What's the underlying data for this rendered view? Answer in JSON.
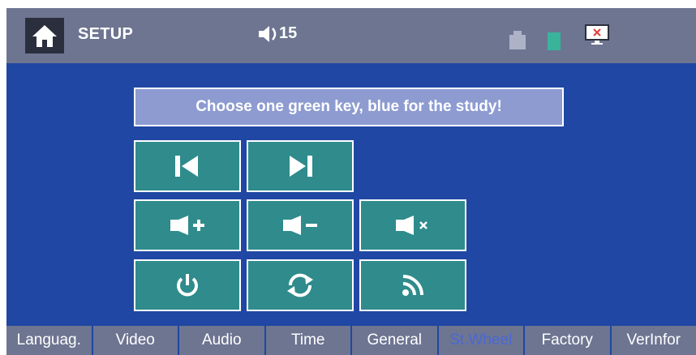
{
  "header": {
    "title": "SETUP",
    "volume_value": "15",
    "icons": {
      "home": "home-icon",
      "volume": "speaker-icon",
      "usb": "usb-icon",
      "sd": "sd-card-icon",
      "screen": "display-off-icon"
    }
  },
  "banner": {
    "text": "Choose one green key, blue for the study!"
  },
  "keys": [
    {
      "name": "previous-track",
      "icon": "skip-previous-icon"
    },
    {
      "name": "next-track",
      "icon": "skip-next-icon"
    },
    {
      "name": "volume-up",
      "icon": "volume-up-icon"
    },
    {
      "name": "volume-down",
      "icon": "volume-down-icon"
    },
    {
      "name": "mute",
      "icon": "mute-icon"
    },
    {
      "name": "power",
      "icon": "power-icon"
    },
    {
      "name": "mode-cycle",
      "icon": "refresh-icon"
    },
    {
      "name": "wireless-signal",
      "icon": "rss-icon"
    }
  ],
  "tabs": [
    {
      "label": "Languag.",
      "active": false
    },
    {
      "label": "Video",
      "active": false
    },
    {
      "label": "Audio",
      "active": false
    },
    {
      "label": "Time",
      "active": false
    },
    {
      "label": "General",
      "active": false
    },
    {
      "label": "St.Wheel",
      "active": true
    },
    {
      "label": "Factory",
      "active": false
    },
    {
      "label": "VerInfor",
      "active": false
    }
  ],
  "colors": {
    "topbar": "#6d7591",
    "main_bg": "#1f47a3",
    "key_green": "#2f8b8c",
    "banner_bg": "#8d9bd1",
    "active_tab": "#4a67d6"
  }
}
